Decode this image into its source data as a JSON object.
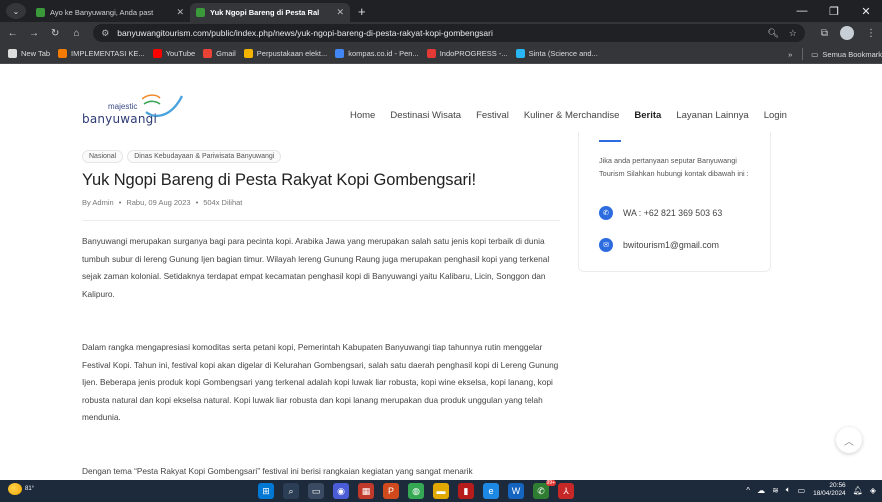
{
  "browser": {
    "tabs": [
      {
        "title": "Ayo ke Banyuwangi, Anda past",
        "active": false
      },
      {
        "title": "Yuk Ngopi Bareng di Pesta Ral",
        "active": true
      }
    ],
    "new_tab_symbol": "+",
    "url": "banyuwangitourism.com/public/index.php/news/yuk-ngopi-bareng-di-pesta-rakyat-kopi-gombengsari",
    "bookmarks": [
      {
        "label": "New Tab",
        "color": "#dddddd"
      },
      {
        "label": "IMPLEMENTASI KE...",
        "color": "#f57c00"
      },
      {
        "label": "YouTube",
        "color": "#ff0000"
      },
      {
        "label": "Gmail",
        "color": "#ea4335"
      },
      {
        "label": "Perpustakaan elekt...",
        "color": "#f4b400"
      },
      {
        "label": "kompas.co.id - Pen...",
        "color": "#4285f4"
      },
      {
        "label": "IndoPROGRESS -...",
        "color": "#e53935"
      },
      {
        "label": "Sinta (Science and...",
        "color": "#29b6f6"
      }
    ],
    "bookmarks_overflow": "»",
    "all_bookmarks": "Semua Bookmark"
  },
  "site": {
    "logo_top": "majestic",
    "logo_bottom": "banyuwangi",
    "nav": [
      "Home",
      "Destinasi Wisata",
      "Festival",
      "Kuliner & Merchandise",
      "Berita",
      "Layanan Lainnya",
      "Login"
    ],
    "nav_active": "Berita"
  },
  "article": {
    "tags": [
      "Nasional",
      "Dinas Kebudayaan & Pariwisata Banyuwangi"
    ],
    "title": "Yuk Ngopi Bareng di Pesta Rakyat Kopi Gombengsari!",
    "author": "By Admin",
    "date": "Rabu, 09 Aug 2023",
    "views": "504x Dilihat",
    "paragraphs": [
      "Banyuwangi merupakan surganya bagi para pecinta kopi. Arabika Jawa yang merupakan salah satu jenis kopi terbaik di dunia tumbuh subur di lereng Gunung Ijen bagian timur. Wilayah lereng Gunung Raung juga merupakan penghasil kopi yang terkenal sejak zaman kolonial. Setidaknya terdapat empat kecamatan penghasil kopi di Banyuwangi yaitu Kalibaru, Licin, Songgon dan Kalipuro.",
      "Dalam rangka mengapresiasi komoditas serta petani kopi, Pemerintah Kabupaten Banyuwangi tiap tahunnya rutin menggelar Festival Kopi. Tahun ini, festival kopi akan digelar di Kelurahan Gombengsari, salah satu daerah penghasil kopi di Lereng Gunung Ijen. Beberapa jenis produk kopi Gombengsari yang terkenal adalah kopi luwak liar robusta, kopi wine ekselsa, kopi lanang, kopi robusta natural dan kopi ekselsa natural. Kopi luwak liar robusta dan kopi lanang merupakan dua produk unggulan yang telah mendunia.",
      "Dengan tema “Pesta Rakyat Kopi Gombengsari” festival ini berisi rangkaian kegiatan yang sangat menarik"
    ]
  },
  "sidebar": {
    "description": "Jika anda pertanyaan seputar Banyuwangi Tourism Silahkan hubungi kontak dibawah ini :",
    "phone": "WA : +62 821 369 503 63",
    "email": "bwitourism1@gmail.com"
  },
  "taskbar": {
    "temperature": "81°",
    "time": "20:56",
    "date": "18/04/2024",
    "badge": "99+"
  },
  "colors": {
    "accent": "#2d6cdf",
    "chrome_dark": "#202124",
    "chrome_mid": "#35363a",
    "taskbar": "#1c2a3c"
  }
}
